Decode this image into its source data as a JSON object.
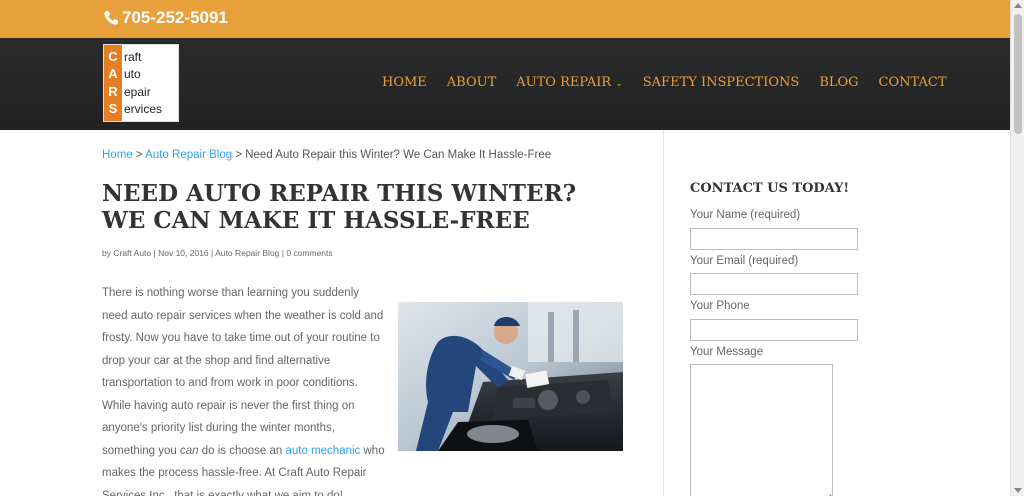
{
  "topbar": {
    "phone": "705-252-5091",
    "icon": "phone-icon"
  },
  "logo": {
    "letters": [
      "C",
      "A",
      "R",
      "S"
    ],
    "words": [
      "raft",
      "uto",
      "epair",
      "ervices"
    ]
  },
  "nav": {
    "items": [
      {
        "label": "HOME"
      },
      {
        "label": "ABOUT"
      },
      {
        "label": "AUTO REPAIR",
        "has_dropdown": true
      },
      {
        "label": "SAFETY INSPECTIONS"
      },
      {
        "label": "BLOG"
      },
      {
        "label": "CONTACT"
      }
    ],
    "dropdown_glyph": "⌄"
  },
  "breadcrumb": {
    "home": "Home",
    "sep": " > ",
    "category": "Auto Repair Blog",
    "current": "Need Auto Repair this Winter? We Can Make It Hassle-Free"
  },
  "post": {
    "title": "NEED AUTO REPAIR THIS WINTER? WE CAN MAKE IT HASSLE-FREE",
    "meta": {
      "by": "by ",
      "author": "Craft Auto",
      "sep": " | ",
      "date": "Nov 10, 2016",
      "category": "Auto Repair Blog",
      "comments": "0 comments"
    },
    "body_part1": "There is nothing worse than learning you suddenly need auto repair services when the weather is cold and frosty. Now you have to take time out of your routine to drop your car at the shop and find alternative transportation to and from work in poor conditions. While having auto repair is never the first thing on anyone's priority list during the winter months, something you ",
    "body_em": "can",
    "body_part2": " do is choose an ",
    "body_link": "auto mechanic",
    "body_part3": " who makes the process hassle-free. At Craft Auto Repair Services Inc., that is exactly what we aim to do!"
  },
  "sidebar": {
    "heading": "CONTACT US TODAY!",
    "fields": {
      "name_label": "Your Name (required)",
      "email_label": "Your Email (required)",
      "phone_label": "Your Phone",
      "message_label": "Your Message"
    }
  },
  "colors": {
    "accent": "#e8a03a",
    "link": "#2ea3f2",
    "header_bg": "#252525"
  }
}
